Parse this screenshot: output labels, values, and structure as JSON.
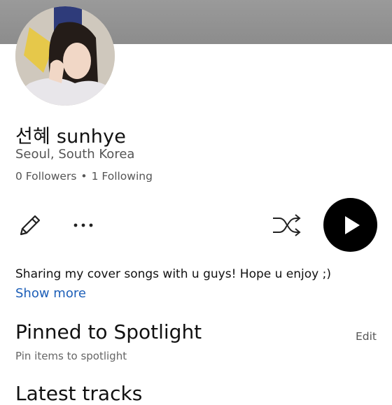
{
  "profile": {
    "name": "선혜 sunhye",
    "location": "Seoul, South Korea",
    "followers": "0 Followers",
    "following": "1 Following",
    "bio": "Sharing my cover songs with u guys! Hope u enjoy ;)",
    "show_more": "Show more"
  },
  "actions": {
    "edit_icon": "pencil-icon",
    "more_icon": "more-options-icon",
    "shuffle_icon": "shuffle-icon",
    "play_icon": "play-icon"
  },
  "spotlight": {
    "title": "Pinned to Spotlight",
    "edit": "Edit",
    "subtitle": "Pin items to spotlight"
  },
  "next_section": {
    "title": "Latest tracks"
  },
  "colors": {
    "header": "#8c8c8c",
    "link": "#1d5fb8",
    "play_bg": "#000000"
  }
}
